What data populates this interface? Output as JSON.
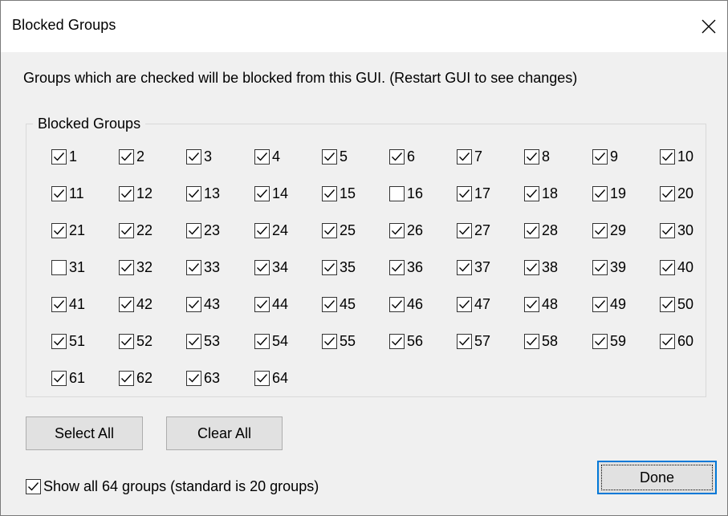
{
  "window": {
    "title": "Blocked Groups",
    "close_icon": "close-icon"
  },
  "instructions": "Groups which are checked will be blocked from this GUI.  (Restart GUI to see changes)",
  "groupbox": {
    "legend": "Blocked Groups",
    "groups": [
      {
        "label": "1",
        "checked": true
      },
      {
        "label": "2",
        "checked": true
      },
      {
        "label": "3",
        "checked": true
      },
      {
        "label": "4",
        "checked": true
      },
      {
        "label": "5",
        "checked": true
      },
      {
        "label": "6",
        "checked": true
      },
      {
        "label": "7",
        "checked": true
      },
      {
        "label": "8",
        "checked": true
      },
      {
        "label": "9",
        "checked": true
      },
      {
        "label": "10",
        "checked": true
      },
      {
        "label": "11",
        "checked": true
      },
      {
        "label": "12",
        "checked": true
      },
      {
        "label": "13",
        "checked": true
      },
      {
        "label": "14",
        "checked": true
      },
      {
        "label": "15",
        "checked": true
      },
      {
        "label": "16",
        "checked": false
      },
      {
        "label": "17",
        "checked": true
      },
      {
        "label": "18",
        "checked": true
      },
      {
        "label": "19",
        "checked": true
      },
      {
        "label": "20",
        "checked": true
      },
      {
        "label": "21",
        "checked": true
      },
      {
        "label": "22",
        "checked": true
      },
      {
        "label": "23",
        "checked": true
      },
      {
        "label": "24",
        "checked": true
      },
      {
        "label": "25",
        "checked": true
      },
      {
        "label": "26",
        "checked": true
      },
      {
        "label": "27",
        "checked": true
      },
      {
        "label": "28",
        "checked": true
      },
      {
        "label": "29",
        "checked": true
      },
      {
        "label": "30",
        "checked": true
      },
      {
        "label": "31",
        "checked": false
      },
      {
        "label": "32",
        "checked": true
      },
      {
        "label": "33",
        "checked": true
      },
      {
        "label": "34",
        "checked": true
      },
      {
        "label": "35",
        "checked": true
      },
      {
        "label": "36",
        "checked": true
      },
      {
        "label": "37",
        "checked": true
      },
      {
        "label": "38",
        "checked": true
      },
      {
        "label": "39",
        "checked": true
      },
      {
        "label": "40",
        "checked": true
      },
      {
        "label": "41",
        "checked": true
      },
      {
        "label": "42",
        "checked": true
      },
      {
        "label": "43",
        "checked": true
      },
      {
        "label": "44",
        "checked": true
      },
      {
        "label": "45",
        "checked": true
      },
      {
        "label": "46",
        "checked": true
      },
      {
        "label": "47",
        "checked": true
      },
      {
        "label": "48",
        "checked": true
      },
      {
        "label": "49",
        "checked": true
      },
      {
        "label": "50",
        "checked": true
      },
      {
        "label": "51",
        "checked": true
      },
      {
        "label": "52",
        "checked": true
      },
      {
        "label": "53",
        "checked": true
      },
      {
        "label": "54",
        "checked": true
      },
      {
        "label": "55",
        "checked": true
      },
      {
        "label": "56",
        "checked": true
      },
      {
        "label": "57",
        "checked": true
      },
      {
        "label": "58",
        "checked": true
      },
      {
        "label": "59",
        "checked": true
      },
      {
        "label": "60",
        "checked": true
      },
      {
        "label": "61",
        "checked": true
      },
      {
        "label": "62",
        "checked": true
      },
      {
        "label": "63",
        "checked": true
      },
      {
        "label": "64",
        "checked": true
      }
    ]
  },
  "buttons": {
    "select_all": "Select All",
    "clear_all": "Clear All",
    "done": "Done"
  },
  "show_all": {
    "label": "Show all 64 groups (standard is 20 groups)",
    "checked": true
  },
  "colors": {
    "focus_accent": "#0078d7",
    "button_face": "#e1e1e1",
    "dialog_background": "#f0f0f0"
  }
}
